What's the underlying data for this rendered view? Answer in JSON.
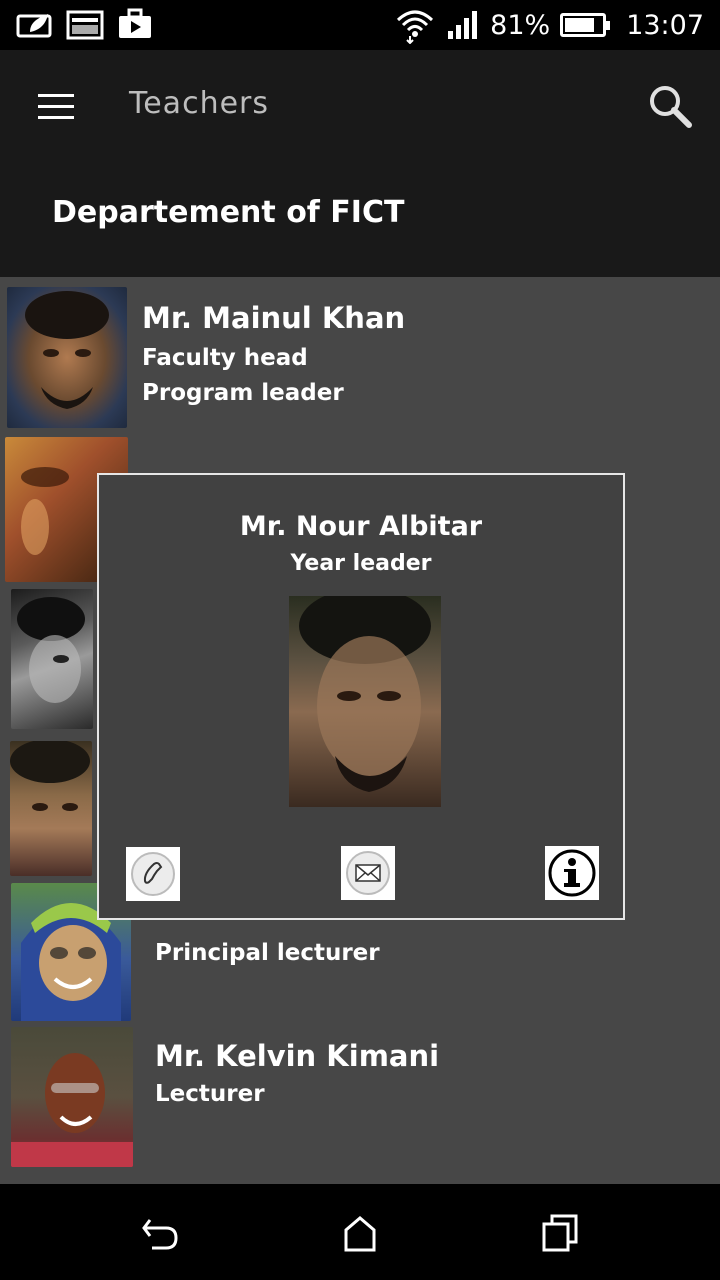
{
  "status_bar": {
    "battery_percent": "81%",
    "battery_level": 0.81,
    "time": "13:07",
    "icons": [
      "leaf-notification-icon",
      "gallery-notification-icon",
      "briefcase-notification-icon",
      "wifi-icon",
      "signal-icon",
      "battery-icon"
    ]
  },
  "app_bar": {
    "title": "Teachers",
    "menu_icon": "hamburger-menu-icon",
    "search_icon": "search-icon"
  },
  "department": "Departement of FICT",
  "teachers": [
    {
      "name": "Mr. Mainul Khan",
      "role1": "Faculty head",
      "role2": "Program leader"
    },
    {
      "name": "",
      "role1": "",
      "role2": ""
    },
    {
      "name": "",
      "role1": "",
      "role2": ""
    },
    {
      "name": "",
      "role1": "",
      "role2": ""
    },
    {
      "name": "",
      "role1": "Principal lecturer",
      "role2": ""
    },
    {
      "name": "Mr. Kelvin Kimani",
      "role1": "Lecturer",
      "role2": ""
    }
  ],
  "dialog": {
    "name": "Mr. Nour Albitar",
    "role": "Year leader",
    "buttons": [
      "phone-icon",
      "email-icon",
      "info-icon"
    ]
  },
  "nav_bar": {
    "buttons": [
      "back-icon",
      "home-icon",
      "recents-icon"
    ]
  },
  "colors": {
    "appbar_bg": "#191919",
    "list_bg": "#474747",
    "dialog_bg": "#414141"
  }
}
